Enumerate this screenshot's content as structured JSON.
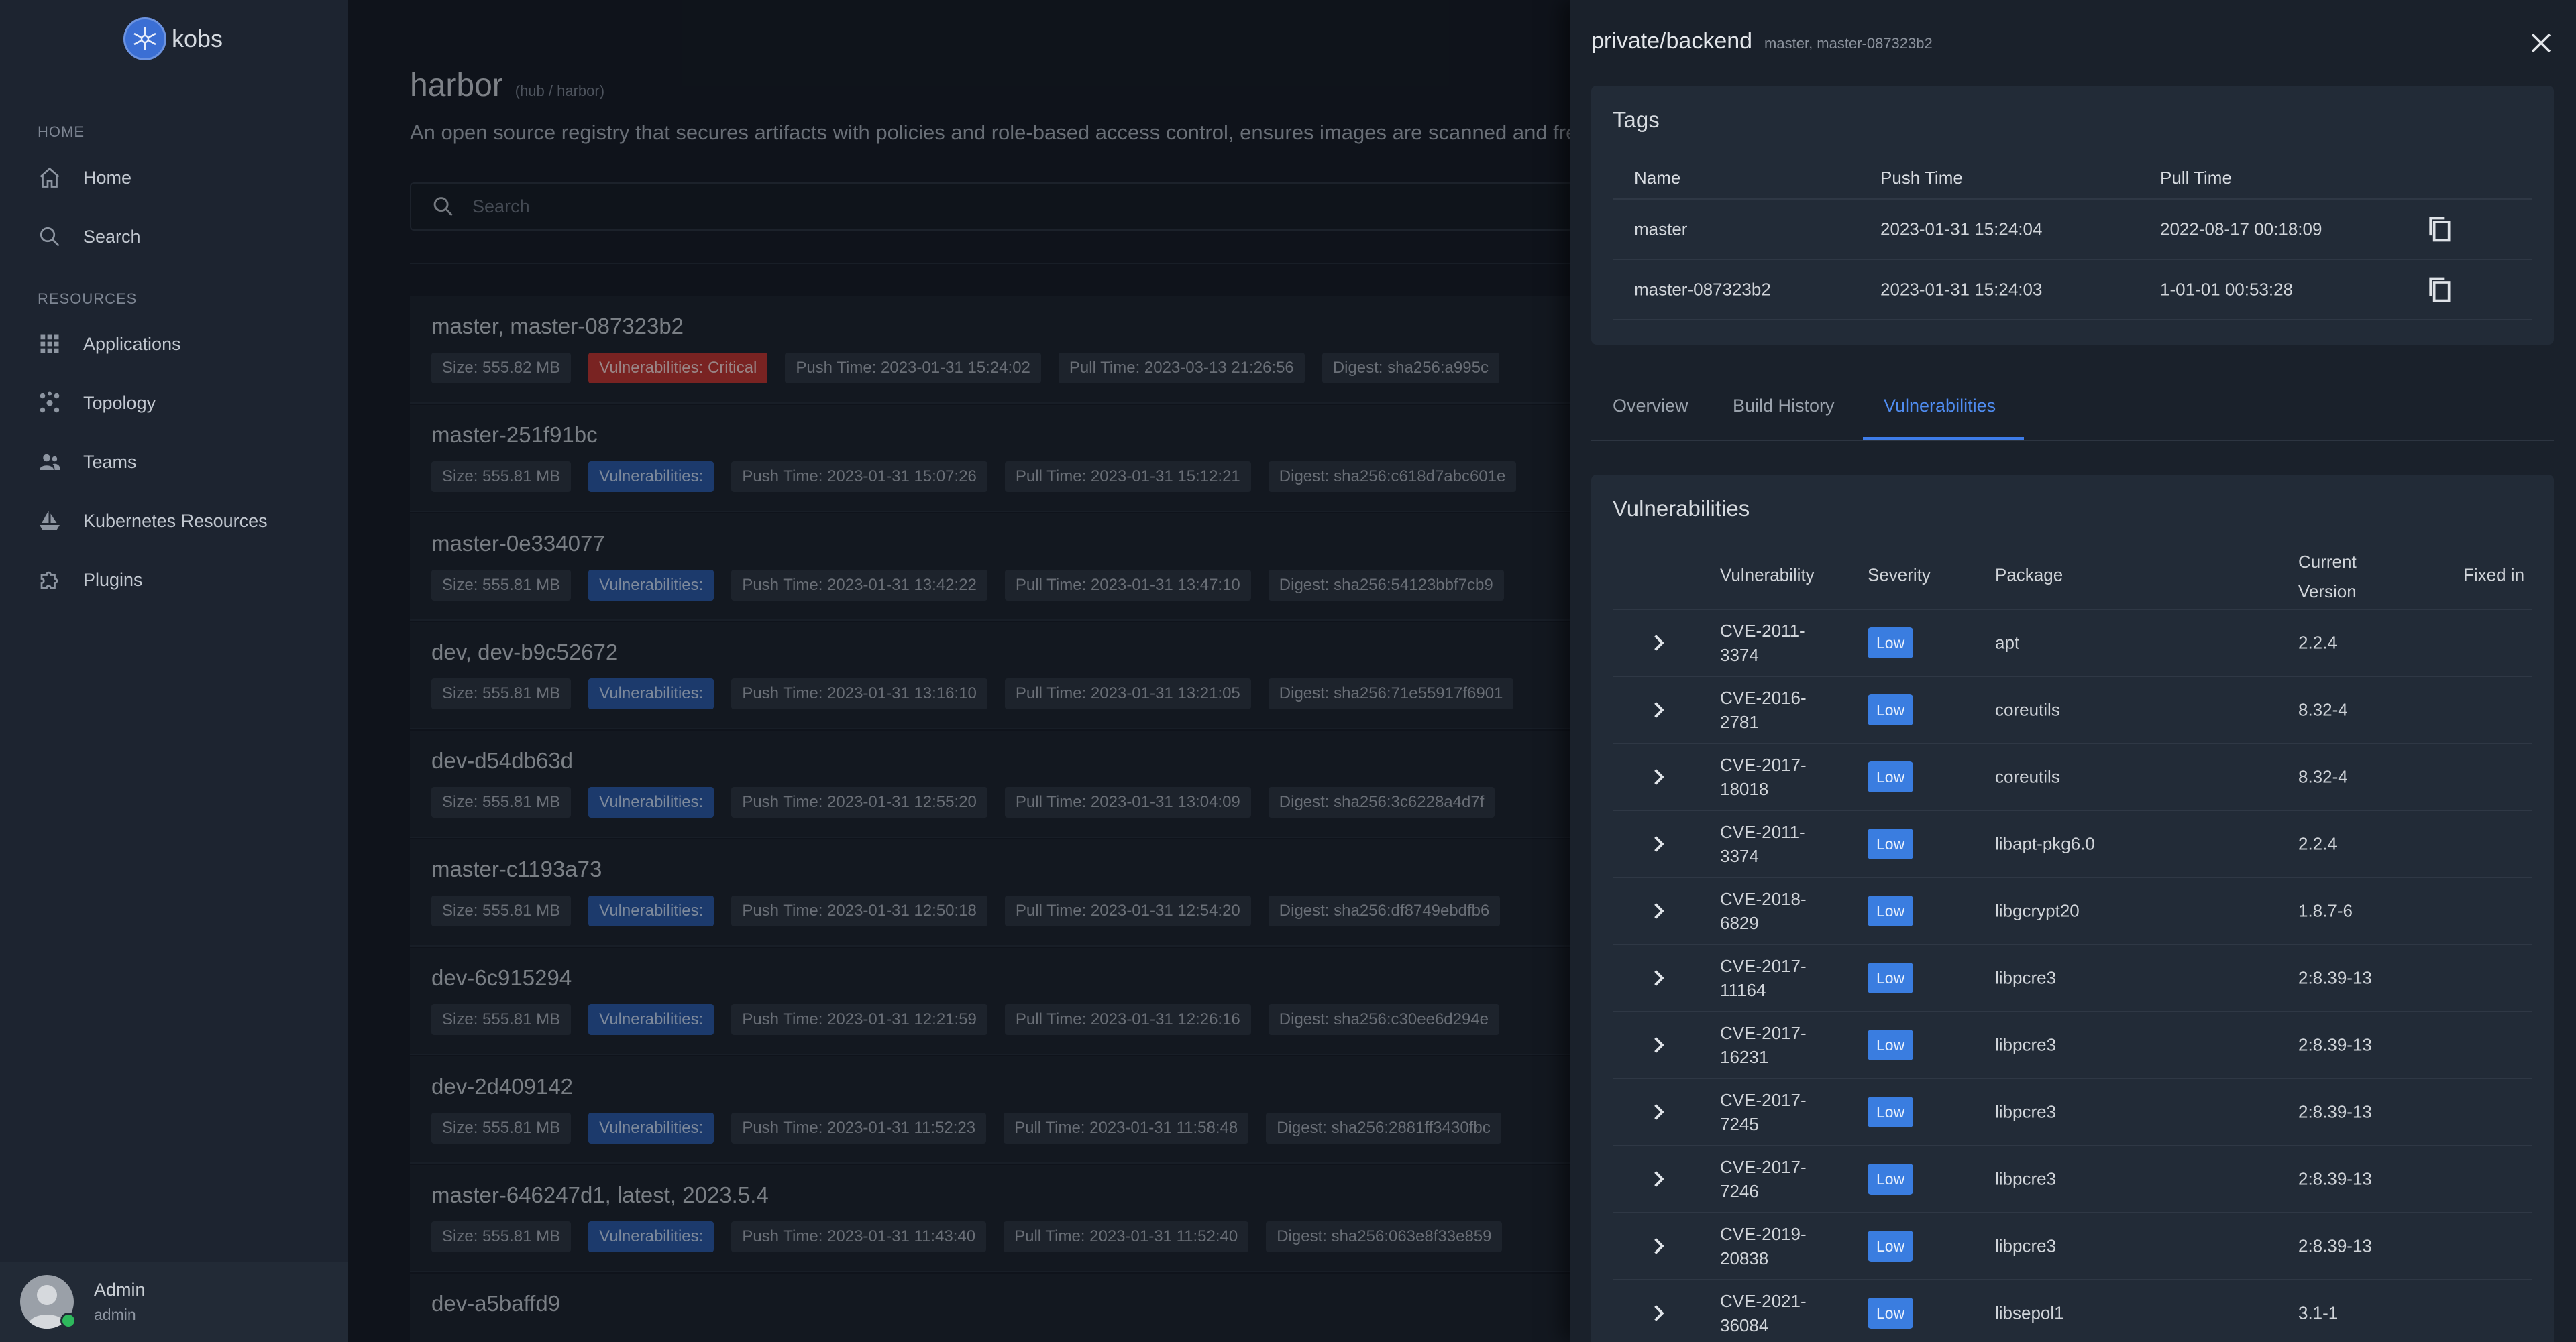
{
  "sidebar": {
    "brand": "kobs",
    "sections": [
      {
        "label": "HOME",
        "items": [
          {
            "label": "Home",
            "icon": "home-icon"
          },
          {
            "label": "Search",
            "icon": "search-icon"
          }
        ]
      },
      {
        "label": "RESOURCES",
        "items": [
          {
            "label": "Applications",
            "icon": "grid-icon"
          },
          {
            "label": "Topology",
            "icon": "topology-icon"
          },
          {
            "label": "Teams",
            "icon": "teams-icon"
          },
          {
            "label": "Kubernetes Resources",
            "icon": "ship-icon"
          },
          {
            "label": "Plugins",
            "icon": "puzzle-icon"
          }
        ]
      }
    ],
    "user": {
      "name": "Admin",
      "role": "admin"
    }
  },
  "main": {
    "title": "harbor",
    "subtitle": "(hub / harbor)",
    "description": "An open source registry that secures artifacts with policies and role-based access control, ensures images are scanned and free",
    "search_placeholder": "Search",
    "artifacts": [
      {
        "name": "master, master-087323b2",
        "size": "Size: 555.82 MB",
        "vulnerabilities": "Vulnerabilities: Critical",
        "severity": "critical",
        "push": "Push Time: 2023-01-31 15:24:02",
        "pull": "Pull Time: 2023-03-13 21:26:56",
        "digest": "Digest: sha256:a995c"
      },
      {
        "name": "master-251f91bc",
        "size": "Size: 555.81 MB",
        "vulnerabilities": "Vulnerabilities:",
        "severity": "none",
        "push": "Push Time: 2023-01-31 15:07:26",
        "pull": "Pull Time: 2023-01-31 15:12:21",
        "digest": "Digest: sha256:c618d7abc601e"
      },
      {
        "name": "master-0e334077",
        "size": "Size: 555.81 MB",
        "vulnerabilities": "Vulnerabilities:",
        "severity": "none",
        "push": "Push Time: 2023-01-31 13:42:22",
        "pull": "Pull Time: 2023-01-31 13:47:10",
        "digest": "Digest: sha256:54123bbf7cb9"
      },
      {
        "name": "dev, dev-b9c52672",
        "size": "Size: 555.81 MB",
        "vulnerabilities": "Vulnerabilities:",
        "severity": "none",
        "push": "Push Time: 2023-01-31 13:16:10",
        "pull": "Pull Time: 2023-01-31 13:21:05",
        "digest": "Digest: sha256:71e55917f6901"
      },
      {
        "name": "dev-d54db63d",
        "size": "Size: 555.81 MB",
        "vulnerabilities": "Vulnerabilities:",
        "severity": "none",
        "push": "Push Time: 2023-01-31 12:55:20",
        "pull": "Pull Time: 2023-01-31 13:04:09",
        "digest": "Digest: sha256:3c6228a4d7f"
      },
      {
        "name": "master-c1193a73",
        "size": "Size: 555.81 MB",
        "vulnerabilities": "Vulnerabilities:",
        "severity": "none",
        "push": "Push Time: 2023-01-31 12:50:18",
        "pull": "Pull Time: 2023-01-31 12:54:20",
        "digest": "Digest: sha256:df8749ebdfb6"
      },
      {
        "name": "dev-6c915294",
        "size": "Size: 555.81 MB",
        "vulnerabilities": "Vulnerabilities:",
        "severity": "none",
        "push": "Push Time: 2023-01-31 12:21:59",
        "pull": "Pull Time: 2023-01-31 12:26:16",
        "digest": "Digest: sha256:c30ee6d294e"
      },
      {
        "name": "dev-2d409142",
        "size": "Size: 555.81 MB",
        "vulnerabilities": "Vulnerabilities:",
        "severity": "none",
        "push": "Push Time: 2023-01-31 11:52:23",
        "pull": "Pull Time: 2023-01-31 11:58:48",
        "digest": "Digest: sha256:2881ff3430fbc"
      },
      {
        "name": "master-646247d1, latest, 2023.5.4",
        "size": "Size: 555.81 MB",
        "vulnerabilities": "Vulnerabilities:",
        "severity": "none",
        "push": "Push Time: 2023-01-31 11:43:40",
        "pull": "Pull Time: 2023-01-31 11:52:40",
        "digest": "Digest: sha256:063e8f33e859"
      },
      {
        "name": "dev-a5baffd9",
        "size": "",
        "vulnerabilities": "",
        "severity": "none",
        "push": "",
        "pull": "",
        "digest": ""
      }
    ]
  },
  "drawer": {
    "title": "private/backend",
    "subtitle": "master, master-087323b2",
    "tags_title": "Tags",
    "tags_headers": [
      "Name",
      "Push Time",
      "Pull Time"
    ],
    "tags": [
      {
        "name": "master",
        "push": "2023-01-31 15:24:04",
        "pull": "2022-08-17 00:18:09"
      },
      {
        "name": "master-087323b2",
        "push": "2023-01-31 15:24:03",
        "pull": "1-01-01 00:53:28"
      }
    ],
    "tabs": [
      "Overview",
      "Build History",
      "Vulnerabilities"
    ],
    "active_tab": "Vulnerabilities",
    "vuln_title": "Vulnerabilities",
    "vuln_headers": {
      "vulnerability": "Vulnerability",
      "severity": "Severity",
      "package": "Package",
      "current_version_1": "Current",
      "current_version_2": "Version",
      "fixed_in": "Fixed in"
    },
    "vulnerabilities": [
      {
        "cve1": "CVE-2011-",
        "cve2": "3374",
        "severity": "Low",
        "package": "apt",
        "version": "2.2.4"
      },
      {
        "cve1": "CVE-2016-",
        "cve2": "2781",
        "severity": "Low",
        "package": "coreutils",
        "version": "8.32-4"
      },
      {
        "cve1": "CVE-2017-",
        "cve2": "18018",
        "severity": "Low",
        "package": "coreutils",
        "version": "8.32-4"
      },
      {
        "cve1": "CVE-2011-",
        "cve2": "3374",
        "severity": "Low",
        "package": "libapt-pkg6.0",
        "version": "2.2.4"
      },
      {
        "cve1": "CVE-2018-",
        "cve2": "6829",
        "severity": "Low",
        "package": "libgcrypt20",
        "version": "1.8.7-6"
      },
      {
        "cve1": "CVE-2017-",
        "cve2": "11164",
        "severity": "Low",
        "package": "libpcre3",
        "version": "2:8.39-13"
      },
      {
        "cve1": "CVE-2017-",
        "cve2": "16231",
        "severity": "Low",
        "package": "libpcre3",
        "version": "2:8.39-13"
      },
      {
        "cve1": "CVE-2017-",
        "cve2": "7245",
        "severity": "Low",
        "package": "libpcre3",
        "version": "2:8.39-13"
      },
      {
        "cve1": "CVE-2017-",
        "cve2": "7246",
        "severity": "Low",
        "package": "libpcre3",
        "version": "2:8.39-13"
      },
      {
        "cve1": "CVE-2019-",
        "cve2": "20838",
        "severity": "Low",
        "package": "libpcre3",
        "version": "2:8.39-13"
      },
      {
        "cve1": "CVE-2021-",
        "cve2": "36084",
        "severity": "Low",
        "package": "libsepol1",
        "version": "3.1-1"
      }
    ]
  }
}
